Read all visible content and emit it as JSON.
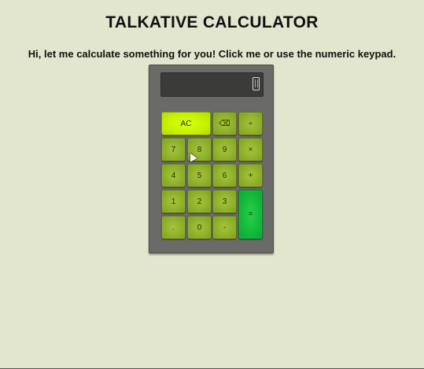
{
  "page": {
    "title": "TALKATIVE CALCULATOR",
    "subtitle": "Hi, let me calculate something for you! Click me or use the numeric keypad."
  },
  "calculator": {
    "display_value": "",
    "keys": {
      "ac": "AC",
      "backspace": "⌫",
      "divide": "÷",
      "seven": "7",
      "eight": "8",
      "nine": "9",
      "multiply": "×",
      "four": "4",
      "five": "5",
      "six": "6",
      "plus": "+",
      "one": "1",
      "two": "2",
      "three": "3",
      "equals": "=",
      "decimal": ".",
      "zero": "0",
      "minus": "-"
    },
    "icons": {
      "display_icon": "mobile-phone-icon"
    },
    "colors": {
      "background": "#e2e6cf",
      "body": "#6a6b68",
      "display": "#3b3c39",
      "key": "#8eb029",
      "ac_key": "#c5f200",
      "equals_key": "#12b93a"
    }
  }
}
